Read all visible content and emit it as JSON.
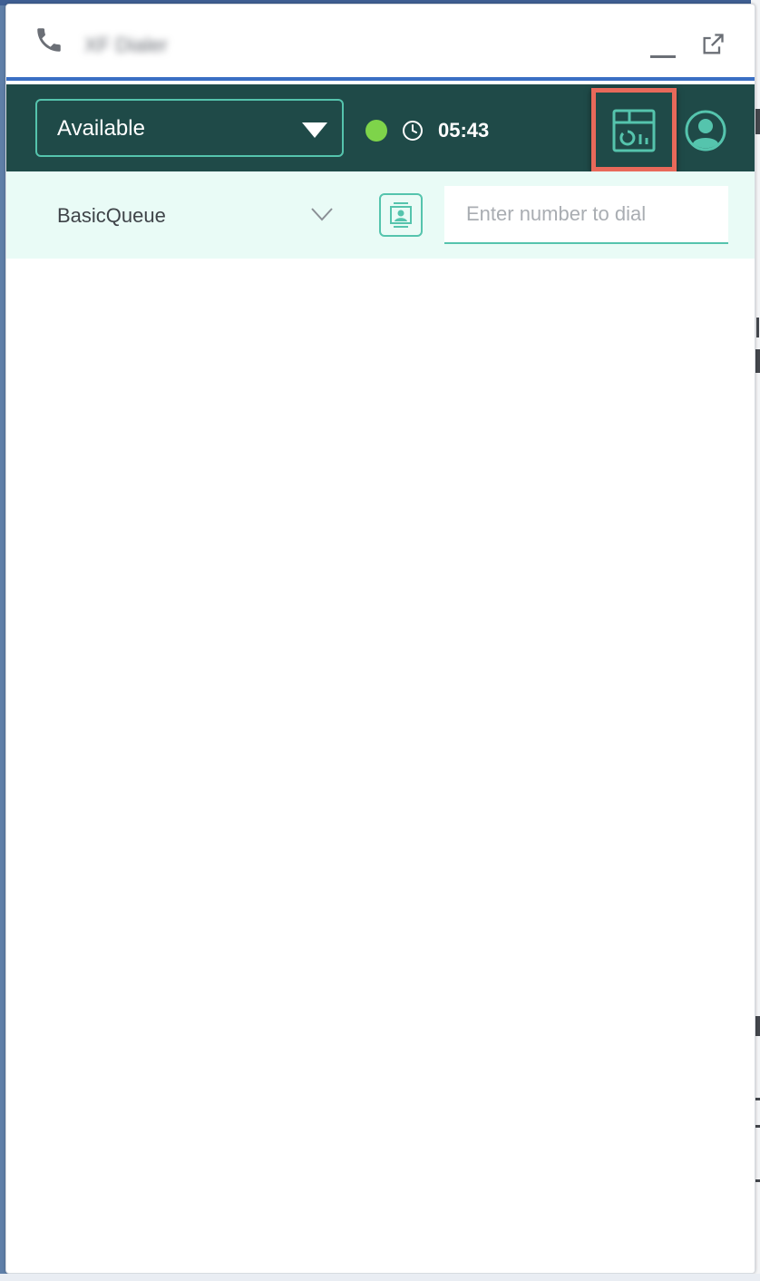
{
  "window": {
    "title": "XF Dialer"
  },
  "toolbar": {
    "status_value": "Available",
    "status_indicator_color": "#7ed44a",
    "timer": "05:43",
    "accent_color": "#55c4ad",
    "background_color": "#1f4a48"
  },
  "subbar": {
    "queue_value": "BasicQueue",
    "dial_placeholder": "Enter number to dial"
  },
  "icons": {
    "phone": "phone-icon",
    "minimize": "minimize-icon",
    "popout": "external-link-icon",
    "clock": "clock-icon",
    "report": "report-dashboard-icon",
    "profile": "user-profile-icon",
    "queue_dropdown": "chevron-down-icon",
    "contacts": "contact-card-icon"
  }
}
